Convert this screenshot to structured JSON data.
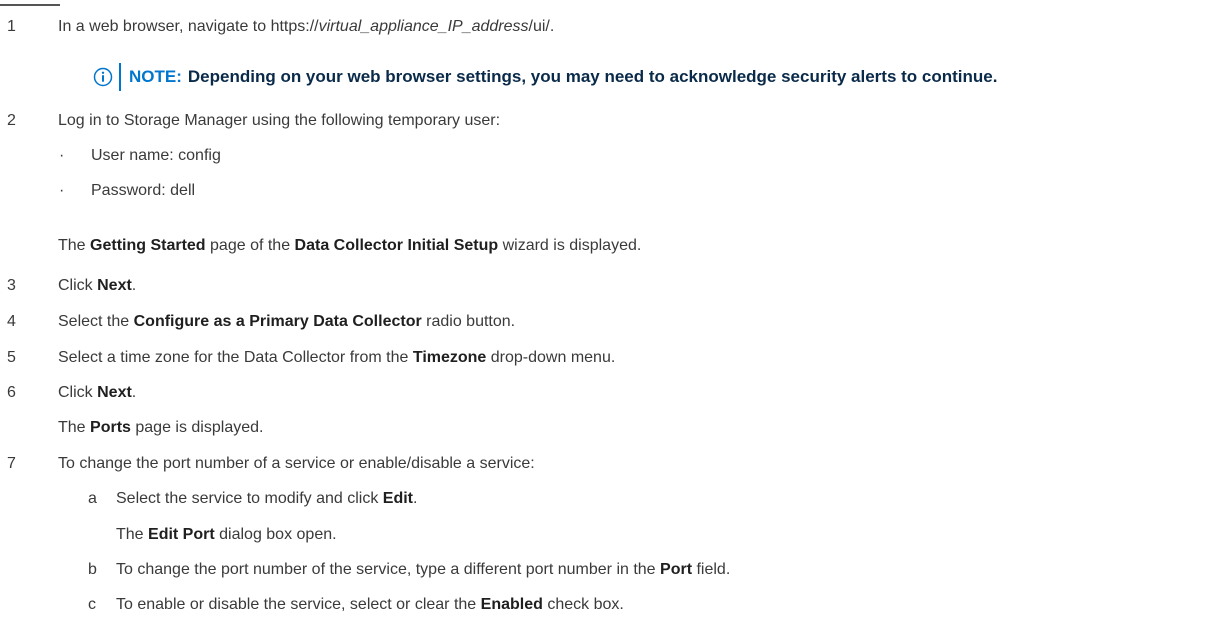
{
  "steps": {
    "s1": {
      "num": "1",
      "prefix": "In a web browser, navigate to https://",
      "italic": "virtual_appliance_IP_address",
      "suffix": "/ui/."
    },
    "note": {
      "label": "NOTE:",
      "text": "Depending on your web browser settings, you may need to acknowledge security alerts to continue."
    },
    "s2": {
      "num": "2",
      "text": "Log in to Storage Manager using the following temporary user:"
    },
    "bullets": [
      "User name: config",
      "Password: dell"
    ],
    "s2_result": {
      "a": "The ",
      "b1": "Getting Started",
      "c": " page of the ",
      "b2": "Data Collector Initial Setup",
      "d": " wizard is displayed."
    },
    "s3": {
      "num": "3",
      "a": "Click ",
      "b": "Next",
      "c": "."
    },
    "s4": {
      "num": "4",
      "a": "Select the ",
      "b": "Configure as a Primary Data Collector",
      "c": " radio button."
    },
    "s5": {
      "num": "5",
      "a": "Select a time zone for the Data Collector from the ",
      "b": "Timezone",
      "c": " drop-down menu."
    },
    "s6": {
      "num": "6",
      "a": "Click ",
      "b": "Next",
      "c": "."
    },
    "s6_result": {
      "a": "The ",
      "b": "Ports",
      "c": " page is displayed."
    },
    "s7": {
      "num": "7",
      "text": "To change the port number of a service or enable/disable a service:"
    },
    "s7a": {
      "letter": "a",
      "a": "Select the service to modify and click ",
      "b": "Edit",
      "c": "."
    },
    "s7a_result": {
      "a": "The ",
      "b": "Edit Port",
      "c": " dialog box open."
    },
    "s7b": {
      "letter": "b",
      "a": "To change the port number of the service, type a different port number in the ",
      "b": "Port",
      "c": " field."
    },
    "s7c": {
      "letter": "c",
      "a": "To enable or disable the service, select or clear the ",
      "b": "Enabled",
      "c": " check box."
    }
  },
  "colors": {
    "accent": "#0076ce",
    "text": "#3a3a3a",
    "note_text": "#0a2a4a"
  },
  "icons": {
    "note": "info-circle-icon",
    "bullet": "bullet-dot"
  }
}
